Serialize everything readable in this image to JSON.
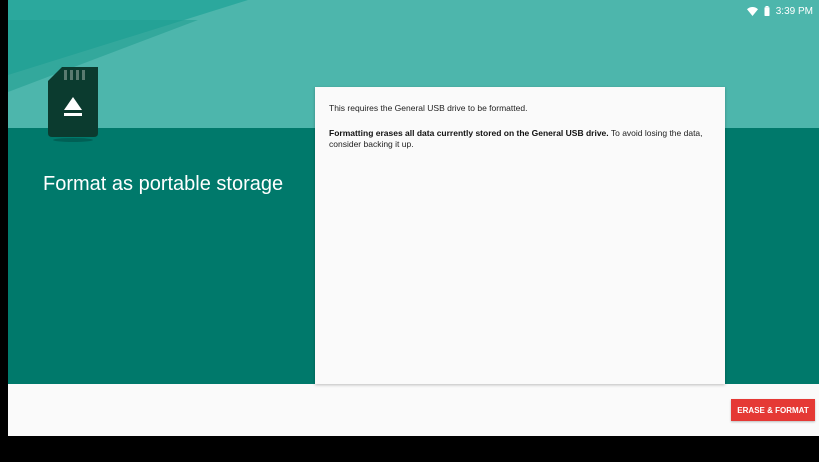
{
  "status_bar": {
    "time": "3:39 PM",
    "icons": [
      "wifi-icon",
      "battery-icon"
    ]
  },
  "hero": {
    "icon": "sd-card-eject-icon",
    "title": "Format as portable storage"
  },
  "content": {
    "message": "This requires the General USB drive to be formatted.",
    "warning_bold": "Formatting erases all data currently stored on the General USB drive.",
    "warning_rest": " To avoid losing the data, consider backing it up."
  },
  "actions": {
    "primary_label": "ERASE & FORMAT"
  },
  "colors": {
    "teal_dark": "#00796b",
    "teal_light": "#4db6ac",
    "button_red": "#e53935",
    "card_bg": "#fafafa"
  }
}
